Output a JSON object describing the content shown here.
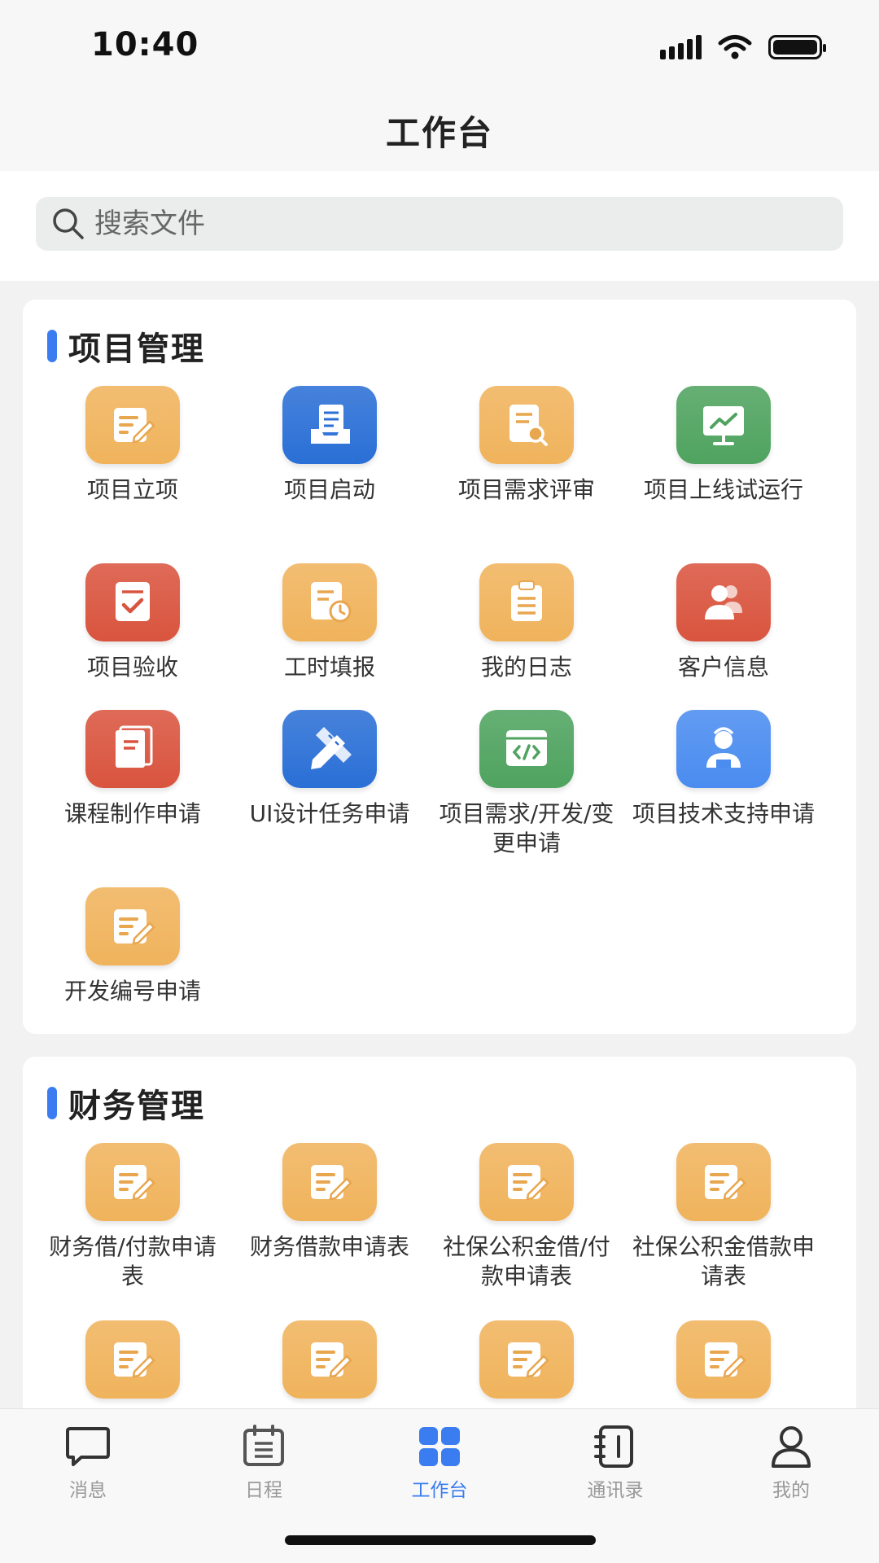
{
  "status_bar": {
    "time": "10:40"
  },
  "nav": {
    "title": "工作台"
  },
  "search": {
    "placeholder": "搜索文件"
  },
  "sections": {
    "project": {
      "title": "项目管理",
      "items": [
        {
          "label": "项目立项",
          "icon": "edit-note-icon",
          "color": "#f0b35c"
        },
        {
          "label": "项目启动",
          "icon": "document-tray-icon",
          "color": "#2a6fd6"
        },
        {
          "label": "项目需求评审",
          "icon": "document-search-icon",
          "color": "#f0b35c"
        },
        {
          "label": "项目上线试运行",
          "icon": "monitor-chart-icon",
          "color": "#4fa35f"
        },
        {
          "label": "项目验收",
          "icon": "checklist-icon",
          "color": "#d9543e"
        },
        {
          "label": "工时填报",
          "icon": "timesheet-clock-icon",
          "color": "#f0b35c"
        },
        {
          "label": "我的日志",
          "icon": "clipboard-list-icon",
          "color": "#f0b35c"
        },
        {
          "label": "客户信息",
          "icon": "customers-icon",
          "color": "#d9543e"
        },
        {
          "label": "课程制作申请",
          "icon": "book-icon",
          "color": "#d9543e"
        },
        {
          "label": "UI设计任务申请",
          "icon": "pencil-ruler-icon",
          "color": "#2a6fd6"
        },
        {
          "label": "项目需求/开发/变更申请",
          "icon": "code-window-icon",
          "color": "#4fa35f"
        },
        {
          "label": "项目技术支持申请",
          "icon": "support-person-icon",
          "color": "#4a8cf0"
        },
        {
          "label": "开发编号申请",
          "icon": "edit-note-icon",
          "color": "#f0b35c"
        }
      ]
    },
    "finance": {
      "title": "财务管理",
      "items": [
        {
          "label": "财务借/付款申请表",
          "icon": "edit-note-icon",
          "color": "#f0b35c"
        },
        {
          "label": "财务借款申请表",
          "icon": "edit-note-icon",
          "color": "#f0b35c"
        },
        {
          "label": "社保公积金借/付款申请表",
          "icon": "edit-note-icon",
          "color": "#f0b35c"
        },
        {
          "label": "社保公积金借款申请表",
          "icon": "edit-note-icon",
          "color": "#f0b35c"
        },
        {
          "label": "",
          "icon": "edit-note-icon",
          "color": "#f0b35c"
        },
        {
          "label": "",
          "icon": "edit-note-icon",
          "color": "#f0b35c"
        },
        {
          "label": "",
          "icon": "edit-note-icon",
          "color": "#f0b35c"
        },
        {
          "label": "",
          "icon": "edit-note-icon",
          "color": "#f0b35c"
        }
      ]
    }
  },
  "tabs": [
    {
      "label": "消息",
      "icon": "chat-bubble-icon",
      "active": false
    },
    {
      "label": "日程",
      "icon": "calendar-icon",
      "active": false
    },
    {
      "label": "工作台",
      "icon": "grid-apps-icon",
      "active": true
    },
    {
      "label": "通讯录",
      "icon": "contacts-book-icon",
      "active": false
    },
    {
      "label": "我的",
      "icon": "user-icon",
      "active": false
    }
  ],
  "colors": {
    "accent": "#3b7df0",
    "tab_inactive": "#999999"
  }
}
